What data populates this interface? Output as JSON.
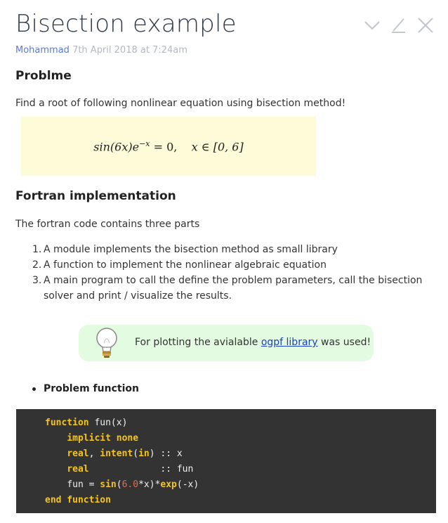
{
  "page": {
    "title": "Bisection example",
    "author": "Mohammad",
    "date": "7th April 2018 at 7:24am"
  },
  "toolbar": {
    "collapse_icon": "chevron-down-icon",
    "edit_icon": "pencil-icon",
    "close_icon": "close-icon"
  },
  "section1": {
    "heading": "Problme",
    "text": "Find a root of following nonlinear equation using bisection method!",
    "equation": {
      "lhs": "sin(6x)e",
      "exponent": "−x",
      "rhs": " = 0,",
      "domain": "x ∈ [0, 6]"
    }
  },
  "section2": {
    "heading": "Fortran implementation",
    "text": "The fortran code contains three parts",
    "items": [
      {
        "num": "1.",
        "text": "A module implements the bisection method as small library"
      },
      {
        "num": "2.",
        "text": "A function to implement the nonlinear algebraic equation"
      },
      {
        "num": "3.",
        "text": "A main program to call the define the problem parameters, call the bisection solver and print / visualize the results."
      }
    ]
  },
  "tip": {
    "icon": "lightbulb-icon",
    "prefix": "For plotting the avialable ",
    "link": "ogpf library",
    "suffix": " was used!"
  },
  "bullet": {
    "label": "Problem function"
  },
  "code": {
    "l1_kw": "function",
    "l1_rest": " fun(x)",
    "l2_kw": "implicit none",
    "l3_kw1": "real",
    "l3_sep": ", ",
    "l3_kw2": "intent",
    "l3_paren1": "(",
    "l3_kw3": "in",
    "l3_rest": ") :: x",
    "l4_kw": "real",
    "l4_rest": "             :: fun",
    "l5_pre": "fun = ",
    "l5_fn1": "sin",
    "l5_p1": "(",
    "l5_num": "6.0",
    "l5_mid": "*x)*",
    "l5_fn2": "exp",
    "l5_end": "(-x)",
    "l6_kw": "end function"
  },
  "colors": {
    "keyword": "#f5c518",
    "number": "#e8694b",
    "code_bg": "#333333",
    "math_bg": "#fdfbd8",
    "tip_bg": "#e3fbe0",
    "link": "#1a3fc4",
    "author": "#5b7bd3"
  }
}
